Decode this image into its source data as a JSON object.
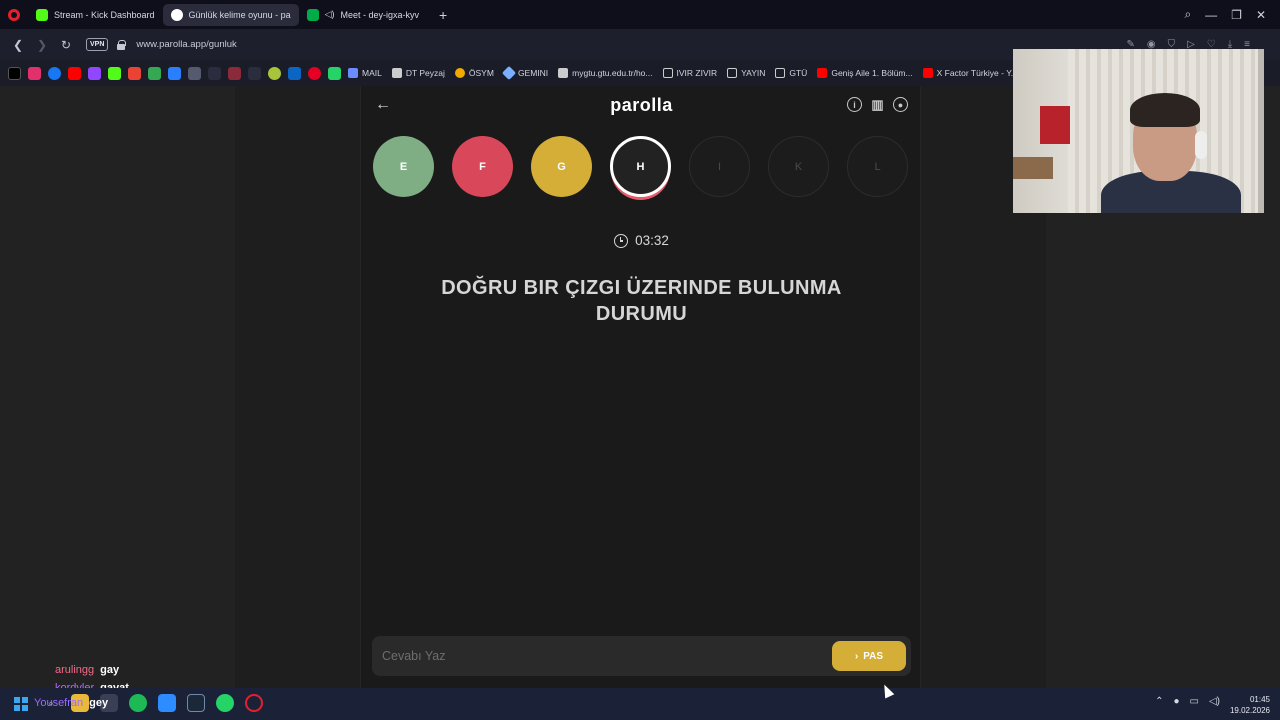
{
  "browser": {
    "tabs": [
      {
        "label": "Stream - Kick Dashboard",
        "icon": "kick-icon",
        "color": "#53fc18",
        "active": false
      },
      {
        "label": "Günlük kelime oyunu - pa",
        "icon": "parolla-icon",
        "color": "#ffffff",
        "active": true
      },
      {
        "label": "Meet - dey-igxa-kyv",
        "icon": "meet-icon",
        "color": "#00ac47",
        "active": false
      }
    ],
    "url": "www.parolla.app/gunluk",
    "vpn_label": "VPN"
  },
  "bookmarks": [
    {
      "label": "MAIL",
      "icon": "mail-icon",
      "color": "#6a8cff"
    },
    {
      "label": "DT Peyzaj",
      "icon": "page-icon",
      "color": "#cccccc"
    },
    {
      "label": "ÖSYM",
      "icon": "osym-icon",
      "color": "#f2a900"
    },
    {
      "label": "GEMINI",
      "icon": "gemini-icon",
      "color": "#7ab0ff"
    },
    {
      "label": "mygtu.gtu.edu.tr/ho...",
      "icon": "page-icon",
      "color": "#cccccc"
    },
    {
      "label": "IVIR ZIVIR",
      "icon": "folder-icon",
      "color": "#cccccc"
    },
    {
      "label": "YAYIN",
      "icon": "folder-icon",
      "color": "#cccccc"
    },
    {
      "label": "GTÜ",
      "icon": "folder-icon",
      "color": "#cccccc"
    },
    {
      "label": "Geniş Aile 1. Bölüm...",
      "icon": "youtube-icon",
      "color": "#ff0000"
    },
    {
      "label": "X Factor Türkiye - Y...",
      "icon": "youtube-icon",
      "color": "#ff0000"
    }
  ],
  "app": {
    "logo": "parolla",
    "letters": [
      {
        "letter": "E",
        "state": "correct",
        "color": "#7fae84"
      },
      {
        "letter": "F",
        "state": "wrong",
        "color": "#d9485a"
      },
      {
        "letter": "G",
        "state": "passed",
        "color": "#d4ae36"
      },
      {
        "letter": "H",
        "state": "current",
        "color": "#222222"
      },
      {
        "letter": "I",
        "state": "pending",
        "color": "#1c1c1c"
      },
      {
        "letter": "K",
        "state": "pending",
        "color": "#1c1c1c"
      },
      {
        "letter": "L",
        "state": "pending",
        "color": "#1c1c1c"
      }
    ],
    "timer": "03:32",
    "question": "DOĞRU BIR ÇIZGI ÜZERINDE BULUNMA DURUMU",
    "answer_placeholder": "Cevabı Yaz",
    "pass_label": "PAS",
    "accent_color": "#d4ae36"
  },
  "chat": [
    {
      "user": "arulingg",
      "message": "gay",
      "color": "#f06b8a"
    },
    {
      "user": "kordyler",
      "message": "gavat",
      "color": "#b06bff"
    },
    {
      "user": "Yousefran",
      "message": "gey",
      "color": "#9b6bff"
    }
  ],
  "taskbar": {
    "time": "01:45",
    "date": "19.02.2026"
  }
}
